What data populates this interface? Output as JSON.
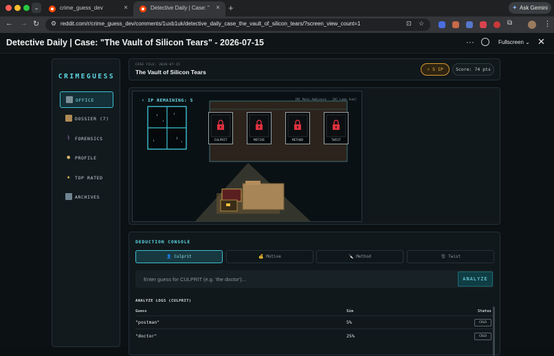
{
  "browser": {
    "tabs": [
      {
        "title": "crime_guess_dev",
        "close": "×"
      },
      {
        "title": "Detective Daily | Case: \"The V",
        "close": "×"
      }
    ],
    "new_tab": "+",
    "ask_gemini": "Ask Gemini",
    "url": "reddit.com/r/crime_guess_dev/comments/1uxb1uk/detective_daily_case_the_vault_of_silicon_tears/?screen_view_count=1"
  },
  "header": {
    "post_title": "Detective Daily | Case: \"The Vault of Silicon Tears\" - 2026-07-15",
    "more": "···",
    "fullscreen_label": "Fullscreen",
    "close": "✕"
  },
  "sidebar": {
    "brand": "CRIMEGUESS",
    "items": [
      {
        "label": "OFFICE",
        "icon": "office-icon",
        "active": true
      },
      {
        "label": "DOSSIER (7)",
        "icon": "dossier-icon",
        "active": false
      },
      {
        "label": "FORENSICS",
        "icon": "forensics-icon",
        "active": false
      },
      {
        "label": "PROFILE",
        "icon": "profile-icon",
        "active": false
      },
      {
        "label": "TOP RATED",
        "icon": "star-icon",
        "active": false
      },
      {
        "label": "ARCHIVES",
        "icon": "archive-icon",
        "active": false
      }
    ]
  },
  "case": {
    "file_label": "CASE FILE: 2026-07-15",
    "name": "The Vault of Silicon Tears",
    "ip_badge": "⚡ 5 IP",
    "score": "Score: 74 pts"
  },
  "scene": {
    "ip_remaining": "⚡ IP REMAINING: 5",
    "ambient_note": "[M] Mute Ambience · [N] Lamp hum]",
    "boards": [
      {
        "label": "CULPRIT"
      },
      {
        "label": "MOTIVE"
      },
      {
        "label": "METHOD"
      },
      {
        "label": "TWIST"
      }
    ]
  },
  "console": {
    "title": "DEDUCTION CONSOLE",
    "tabs": [
      {
        "label": "👤 Culprit",
        "active": true
      },
      {
        "label": "💰 Motive",
        "active": false
      },
      {
        "label": "🔪 Method",
        "active": false
      },
      {
        "label": "🌪 Twist",
        "active": false
      }
    ],
    "input_placeholder": "Enter guess for CULPRIT (e.g. 'the doctor')...",
    "analyze_label": "ANALYZE",
    "logs_title": "ANALYZE LOGS (CULPRIT)",
    "columns": {
      "guess": "Guess",
      "sim": "Sim",
      "status": "Status"
    },
    "rows": [
      {
        "guess": "\"postman\"",
        "sim": "5%",
        "status": "COLD"
      },
      {
        "guess": "\"doctor\"",
        "sim": "25%",
        "status": "COLD"
      }
    ]
  },
  "colors": {
    "accent": "#5fd8e6",
    "ip_gold": "#f0b543",
    "lock_red": "#e0313f",
    "background": "#0c1114"
  }
}
